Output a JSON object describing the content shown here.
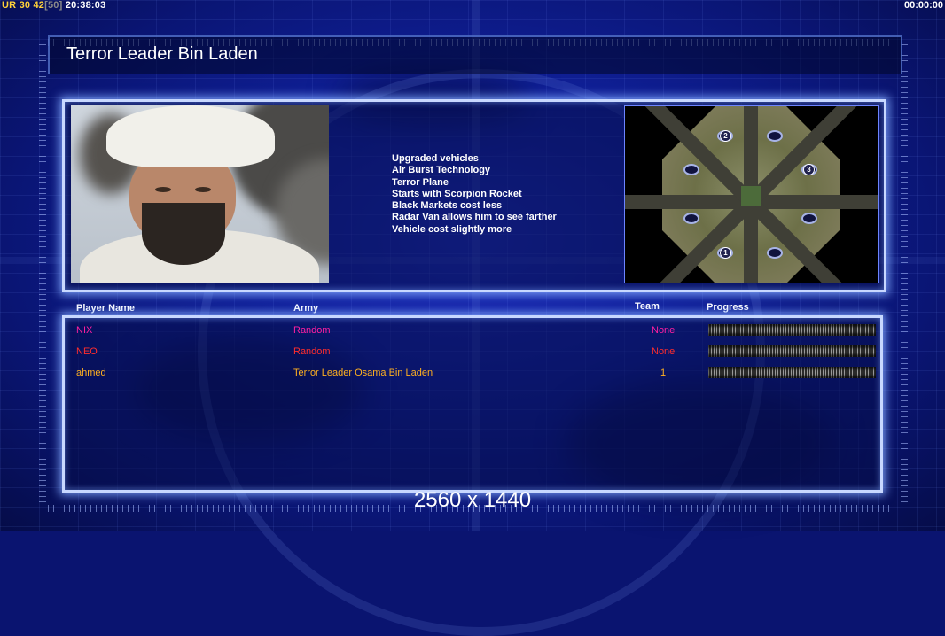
{
  "status": {
    "ur_label": "UR",
    "ur_value": "30",
    "fps": "42",
    "fps_limit": "[50]",
    "clock": "20:38:03",
    "timer": "00:00:00"
  },
  "general": {
    "title": "Terror Leader Bin Laden",
    "features": [
      "Upgraded vehicles",
      "Air Burst Technology",
      "Terror Plane",
      "Starts with Scorpion Rocket",
      "Black Markets cost less",
      "Radar Van allows him to see farther",
      "Vehicle cost slightly more"
    ]
  },
  "minimap": {
    "base_labels": [
      "2",
      "3",
      "1"
    ]
  },
  "players_table": {
    "headers": {
      "name": "Player Name",
      "army": "Army",
      "team": "Team",
      "progress": "Progress"
    },
    "rows": [
      {
        "name": "NIX",
        "army": "Random",
        "team": "None",
        "color": "#ff1fa0"
      },
      {
        "name": "NEO",
        "army": "Random",
        "team": "None",
        "color": "#ff2d2d"
      },
      {
        "name": "ahmed",
        "army": "Terror Leader Osama Bin Laden",
        "team": "1",
        "color": "#ffb020"
      }
    ]
  },
  "resolution": "2560 x 1440",
  "colors": {
    "panel_border": "#c8d8ff",
    "background": "#0a1470"
  }
}
